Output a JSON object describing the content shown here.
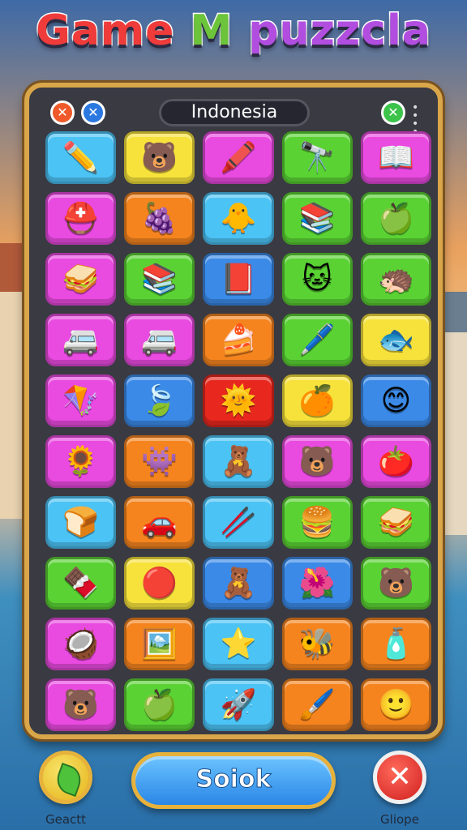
{
  "title": {
    "part1": "Game",
    "part2": "M",
    "part3": "puzzcla"
  },
  "board": {
    "header": "Indonesia"
  },
  "tiles": [
    {
      "color": "#4cc3f5",
      "icon": "purple-pencil",
      "glyph": "✏️"
    },
    {
      "color": "#f7e23c",
      "icon": "bear-face",
      "glyph": "🐻"
    },
    {
      "color": "#e94ae0",
      "icon": "markers",
      "glyph": "🖍️"
    },
    {
      "color": "#5ad234",
      "icon": "telescope",
      "glyph": "🔭"
    },
    {
      "color": "#e94ae0",
      "icon": "open-book",
      "glyph": "📖"
    },
    {
      "color": "#e94ae0",
      "icon": "helmet",
      "glyph": "⛑️"
    },
    {
      "color": "#f5841f",
      "icon": "plum-fruit",
      "glyph": "🍇"
    },
    {
      "color": "#4cc3f5",
      "icon": "cute-creature",
      "glyph": "🐥"
    },
    {
      "color": "#5ad234",
      "icon": "book-stack",
      "glyph": "📚"
    },
    {
      "color": "#5ad234",
      "icon": "green-fruit",
      "glyph": "🍏"
    },
    {
      "color": "#e94ae0",
      "icon": "sandwich",
      "glyph": "🥪"
    },
    {
      "color": "#5ad234",
      "icon": "book-stack",
      "glyph": "📚"
    },
    {
      "color": "#3b8ae8",
      "icon": "flag-book",
      "glyph": "📕"
    },
    {
      "color": "#5ad234",
      "icon": "cat-face",
      "glyph": "🐱"
    },
    {
      "color": "#5ad234",
      "icon": "hedgehog",
      "glyph": "🦔"
    },
    {
      "color": "#e94ae0",
      "icon": "van",
      "glyph": "🚐"
    },
    {
      "color": "#e94ae0",
      "icon": "van",
      "glyph": "🚐"
    },
    {
      "color": "#f5841f",
      "icon": "layer-cake",
      "glyph": "🍰"
    },
    {
      "color": "#5ad234",
      "icon": "marker-pen",
      "glyph": "🖊️"
    },
    {
      "color": "#f7e23c",
      "icon": "fish",
      "glyph": "🐟"
    },
    {
      "color": "#e94ae0",
      "icon": "kite",
      "glyph": "🪁"
    },
    {
      "color": "#3b8ae8",
      "icon": "leaf-pod",
      "glyph": "🍃"
    },
    {
      "color": "#e8281e",
      "icon": "sun-face",
      "glyph": "🌞"
    },
    {
      "color": "#f7e23c",
      "icon": "orange-fruit",
      "glyph": "🍊"
    },
    {
      "color": "#3b8ae8",
      "icon": "smiley",
      "glyph": "😊"
    },
    {
      "color": "#e94ae0",
      "icon": "sunflower",
      "glyph": "🌻"
    },
    {
      "color": "#f5841f",
      "icon": "blob-creature",
      "glyph": "👾"
    },
    {
      "color": "#4cc3f5",
      "icon": "bear-face",
      "glyph": "🧸"
    },
    {
      "color": "#e94ae0",
      "icon": "bear-flower",
      "glyph": "🐻"
    },
    {
      "color": "#e94ae0",
      "icon": "tomato",
      "glyph": "🍅"
    },
    {
      "color": "#4cc3f5",
      "icon": "bread",
      "glyph": "🍞"
    },
    {
      "color": "#f5841f",
      "icon": "car",
      "glyph": "🚗"
    },
    {
      "color": "#4cc3f5",
      "icon": "crossed-tools",
      "glyph": "🥢"
    },
    {
      "color": "#5ad234",
      "icon": "burger",
      "glyph": "🍔"
    },
    {
      "color": "#5ad234",
      "icon": "sandwich",
      "glyph": "🥪"
    },
    {
      "color": "#5ad234",
      "icon": "chocolate",
      "glyph": "🍫"
    },
    {
      "color": "#f7e23c",
      "icon": "red-ball",
      "glyph": "🔴"
    },
    {
      "color": "#3b8ae8",
      "icon": "teddy",
      "glyph": "🧸"
    },
    {
      "color": "#3b8ae8",
      "icon": "flower",
      "glyph": "🌺"
    },
    {
      "color": "#5ad234",
      "icon": "bear-face",
      "glyph": "🐻"
    },
    {
      "color": "#e94ae0",
      "icon": "coconut",
      "glyph": "🥥"
    },
    {
      "color": "#f5841f",
      "icon": "picture-card",
      "glyph": "🖼️"
    },
    {
      "color": "#4cc3f5",
      "icon": "star",
      "glyph": "⭐"
    },
    {
      "color": "#f5841f",
      "icon": "bee",
      "glyph": "🐝"
    },
    {
      "color": "#f5841f",
      "icon": "paint-tubes",
      "glyph": "🧴"
    },
    {
      "color": "#e94ae0",
      "icon": "bear-face",
      "glyph": "🐻"
    },
    {
      "color": "#5ad234",
      "icon": "green-fruit",
      "glyph": "🍏"
    },
    {
      "color": "#4cc3f5",
      "icon": "rocket",
      "glyph": "🚀"
    },
    {
      "color": "#f5841f",
      "icon": "brush",
      "glyph": "🖌️"
    },
    {
      "color": "#f5841f",
      "icon": "blue-smiley",
      "glyph": "🙂"
    }
  ],
  "buttons": {
    "main": "Soiok",
    "left_label": "Geactt",
    "right_label": "Gliope"
  }
}
